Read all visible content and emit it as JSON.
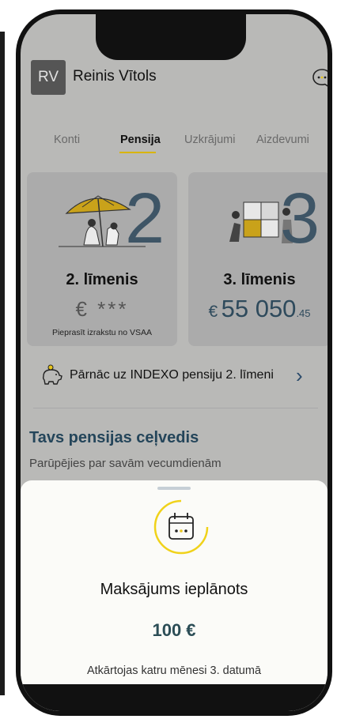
{
  "user": {
    "initials": "RV",
    "name": "Reinis Vītols"
  },
  "tabs": [
    {
      "label": "Konti"
    },
    {
      "label": "Pensija"
    },
    {
      "label": "Uzkrājumi"
    },
    {
      "label": "Aizdevumi"
    }
  ],
  "active_tab": "Pensija",
  "cards": {
    "left": {
      "number": "2",
      "title": "2. līmenis",
      "masked_value": "€ ***",
      "note": "Pieprasīt izrakstu no VSAA"
    },
    "right": {
      "number": "3",
      "title": "3. līmenis",
      "currency": "€",
      "amount_int": "55 050",
      "amount_dec": ".45"
    }
  },
  "promo": {
    "text": "Pārnāc uz INDEXO pensiju 2. līmeni",
    "icon": "piggy-bank-icon"
  },
  "guide": {
    "title": "Tavs pensijas ceļvedis",
    "subtitle": "Parūpējies par savām vecumdienām"
  },
  "sheet": {
    "icon": "calendar-icon",
    "title": "Maksājums ieplānots",
    "amount": "100 €",
    "note": "Atkārtojas katru mēnesi 3. datumā"
  },
  "colors": {
    "accent_yellow": "#f0d21a",
    "navy": "#2e4a5c",
    "sheet_bg": "#fbfbf8"
  }
}
